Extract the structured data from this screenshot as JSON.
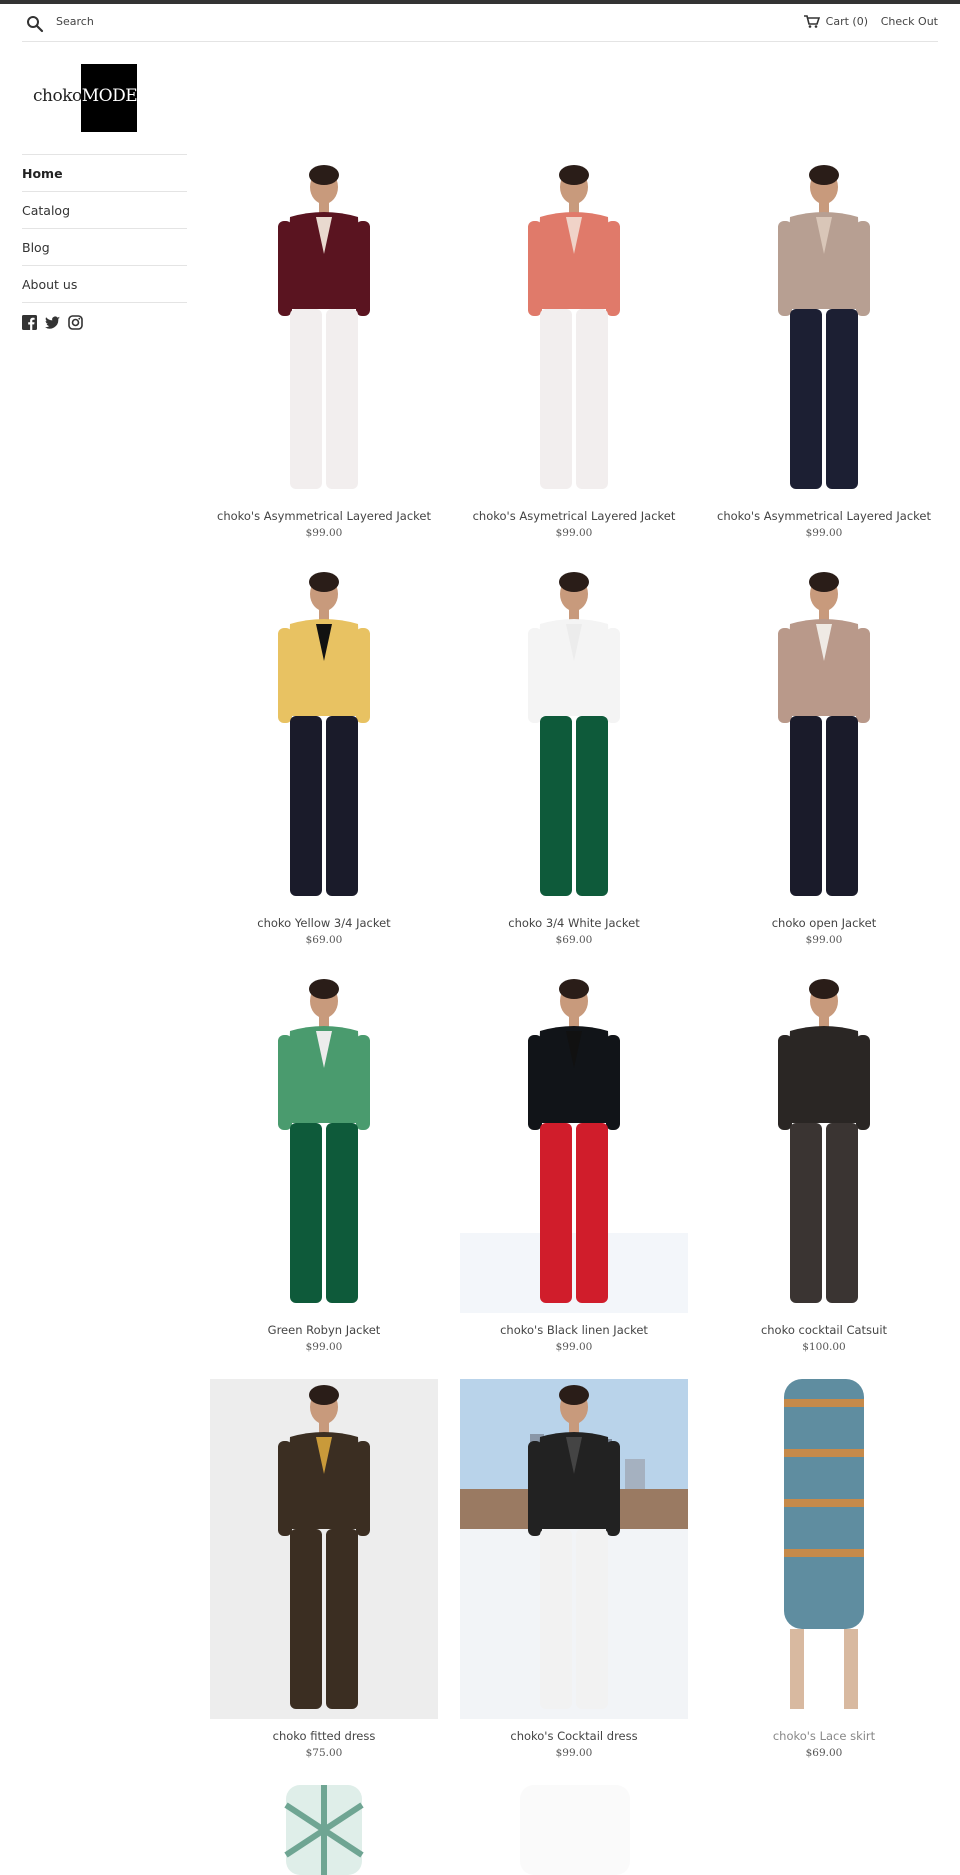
{
  "header": {
    "search_label": "Search",
    "cart_label": "Cart (0)",
    "checkout_label": "Check Out"
  },
  "logo": {
    "part1": "choko",
    "part2": "MODE"
  },
  "nav": {
    "items": [
      {
        "label": "Home"
      },
      {
        "label": "Catalog"
      },
      {
        "label": "Blog"
      },
      {
        "label": "About us"
      }
    ]
  },
  "social": [
    "facebook-icon",
    "twitter-icon",
    "instagram-icon"
  ],
  "products": [
    {
      "title": "choko's Asymmetrical Layered Jacket",
      "price": "$99.00",
      "jacket": "#5a1420",
      "pants": "#f2eeee",
      "top": "#e9d9cf"
    },
    {
      "title": "choko's Asymetrical Layered Jacket",
      "price": "$99.00",
      "jacket": "#e07a6a",
      "pants": "#f2eeee",
      "top": "#f0d3c8"
    },
    {
      "title": "choko's Asymmetrical Layered Jacket",
      "price": "$99.00",
      "jacket": "#b79f92",
      "pants": "#1c1f33",
      "top": "#d9c6b8"
    },
    {
      "title": "choko Yellow 3/4 Jacket",
      "price": "$69.00",
      "jacket": "#e8c262",
      "pants": "#1a1b2a",
      "top": "#111111"
    },
    {
      "title": "choko 3/4 White Jacket",
      "price": "$69.00",
      "jacket": "#f4f4f4",
      "pants": "#0e5a3a",
      "top": "#ececec"
    },
    {
      "title": "choko open Jacket",
      "price": "$99.00",
      "jacket": "#b9998a",
      "pants": "#1a1b2a",
      "top": "#efeae4"
    },
    {
      "title": "Green Robyn Jacket",
      "price": "$99.00",
      "jacket": "#4a9b6e",
      "pants": "#0e5a3a",
      "top": "#ececec"
    },
    {
      "title": "choko's Black linen Jacket",
      "price": "$99.00",
      "jacket": "#111418",
      "pants": "#d01d2b",
      "top": "#111111"
    },
    {
      "title": "choko cocktail Catsuit",
      "price": "$100.00",
      "jacket": "#2a2624",
      "pants": "#3a3432",
      "top": "#2a2624"
    },
    {
      "title": "choko fitted dress",
      "price": "$75.00",
      "jacket": "#3b2e22",
      "pants": "#3b2e22",
      "top": "#c99a3a"
    },
    {
      "title": "choko's Cocktail dress",
      "price": "$99.00",
      "jacket": "#222222",
      "pants": "#f2f2f2",
      "top": "#444444"
    },
    {
      "title": "choko's Lace skirt",
      "price": "$69.00",
      "jacket": "#ffffff",
      "pants": "#5f8da0",
      "top": "#ffffff"
    }
  ]
}
